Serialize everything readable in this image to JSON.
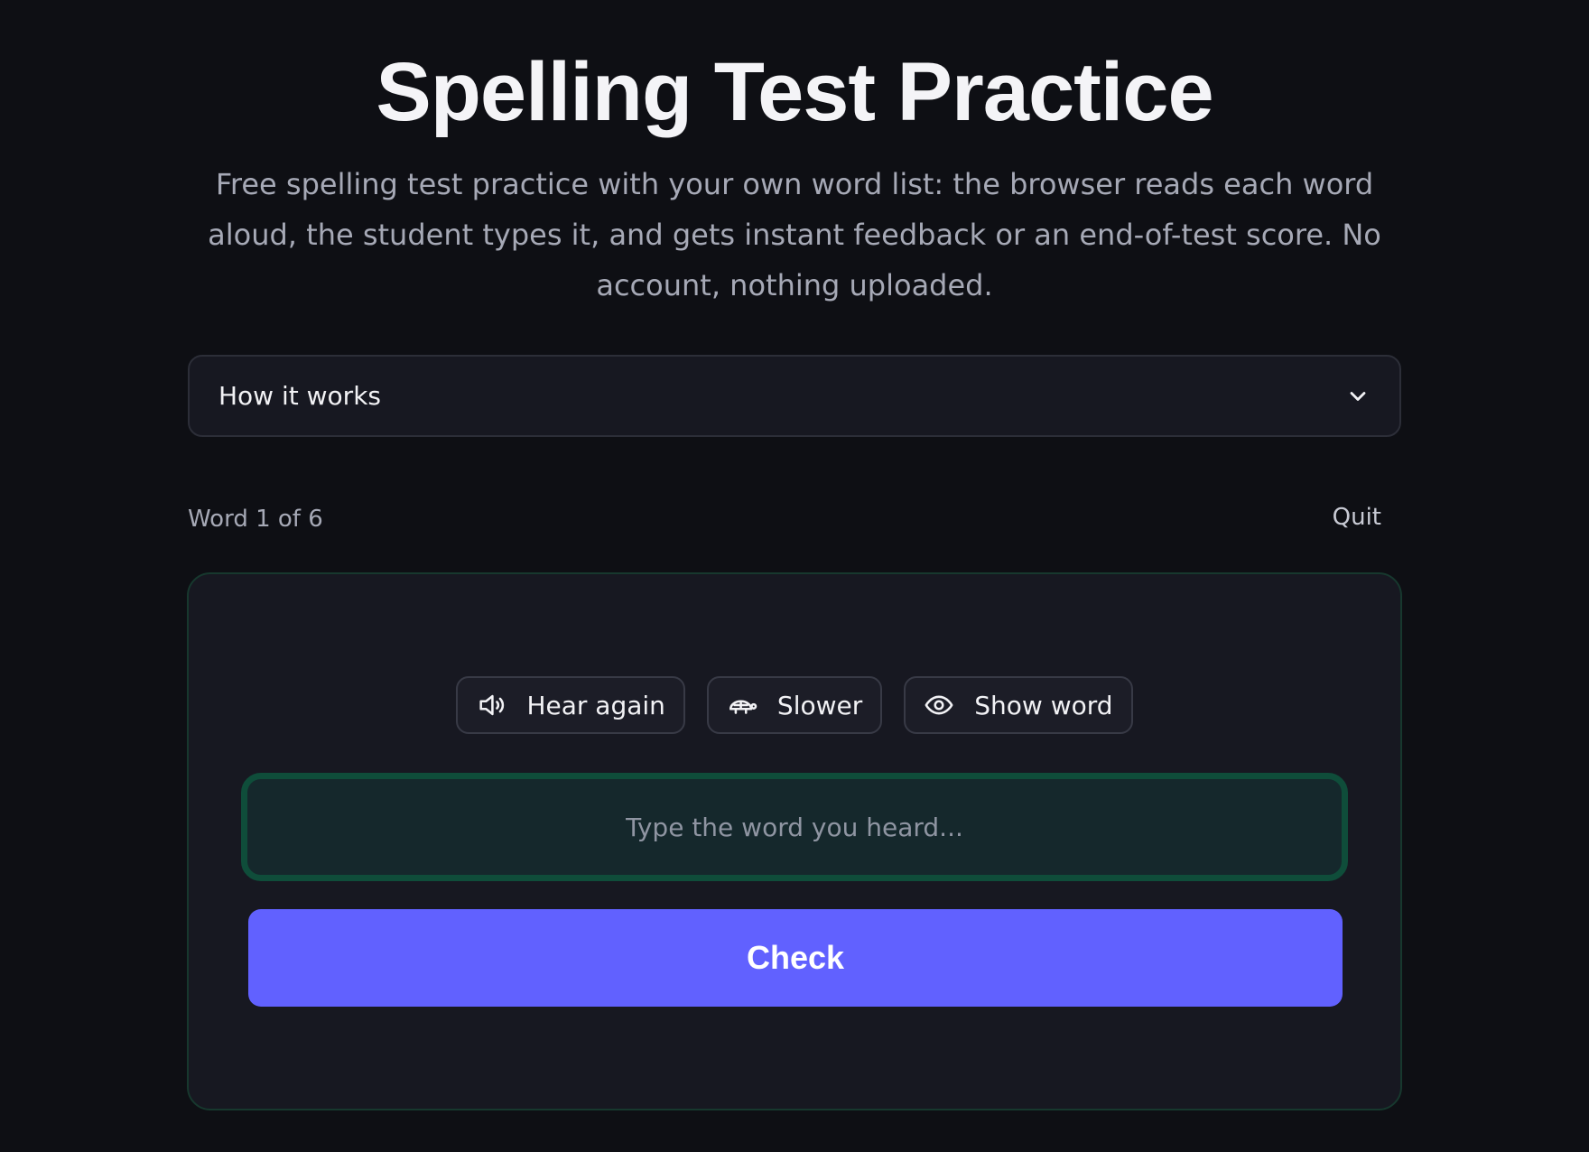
{
  "header": {
    "title": "Spelling Test Practice",
    "subtitle": "Free spelling test practice with your own word list: the browser reads each word aloud, the student types it, and gets instant feedback or an end-of-test score. No account, nothing uploaded."
  },
  "accordion": {
    "label": "How it works",
    "icon": "chevron-down-icon"
  },
  "test": {
    "progress_label": "Word 1 of 6",
    "current_word": 1,
    "total_words": 6,
    "quit_label": "Quit"
  },
  "actions": [
    {
      "label": "Hear again",
      "icon": "speaker-icon"
    },
    {
      "label": "Slower",
      "icon": "turtle-icon"
    },
    {
      "label": "Show word",
      "icon": "eye-icon"
    }
  ],
  "answer": {
    "value": "",
    "placeholder": "Type the word you heard..."
  },
  "check_label": "Check",
  "colors": {
    "background": "#0e0f14",
    "card": "#171821",
    "input_border": "#0f4d3a",
    "primary_button": "#6161ff"
  }
}
